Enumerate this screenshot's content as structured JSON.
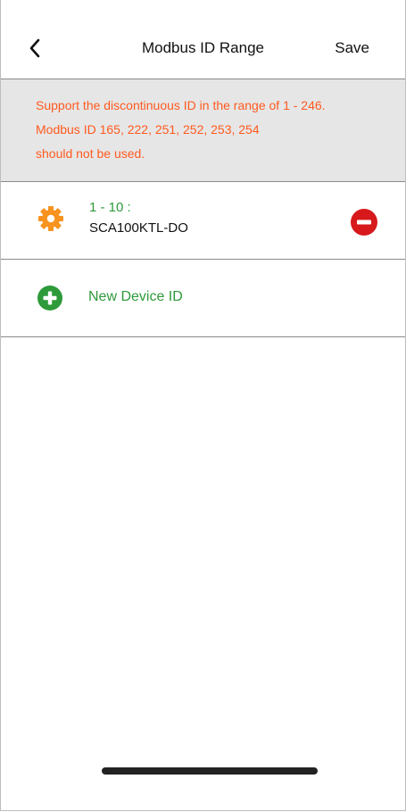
{
  "header": {
    "title": "Modbus ID Range",
    "save_label": "Save",
    "back_icon": "chevron-left-icon"
  },
  "notice": {
    "lines": [
      "Support the discontinuous ID in the range of 1 - 246.",
      "Modbus ID 165, 222, 251, 252, 253, 254",
      "should not be used."
    ],
    "color": "#ff5a1f",
    "background": "#e6e6e6"
  },
  "devices": [
    {
      "range": "1 - 10 :",
      "name": "SCA100KTL-DO",
      "settings_icon": "gear-icon",
      "remove_icon": "minus-circle-icon"
    }
  ],
  "add_device": {
    "label": "New Device ID",
    "icon": "plus-circle-icon"
  },
  "colors": {
    "accent_green": "#2e9a3a",
    "gear_orange": "#f7931e",
    "remove_red": "#d7191c",
    "notice_orange": "#ff5a1f"
  }
}
